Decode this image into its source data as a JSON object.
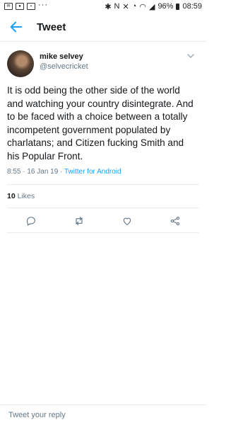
{
  "status_bar": {
    "battery": "96%",
    "time": "08:59"
  },
  "header": {
    "title": "Tweet"
  },
  "tweet": {
    "name": "mike selvey",
    "handle": "@selvecricket",
    "text": "It is odd being the other side of the world and watching your country disintegrate. And to be faced with a choice between a totally incompetent government populated by charlatans; and Citizen fucking Smith and his Popular Front.",
    "timestamp": "8:55 · 16 Jan 19 · ",
    "source": "Twitter for Android",
    "likes_count": "10",
    "likes_label": " Likes"
  },
  "reply": {
    "placeholder": "Tweet your reply"
  },
  "icons": [
    "back-arrow-icon",
    "chevron-down-icon",
    "reply-icon",
    "retweet-icon",
    "like-icon",
    "share-icon"
  ],
  "colors": {
    "accent": "#1da1f2",
    "secondary_text": "#657786"
  }
}
